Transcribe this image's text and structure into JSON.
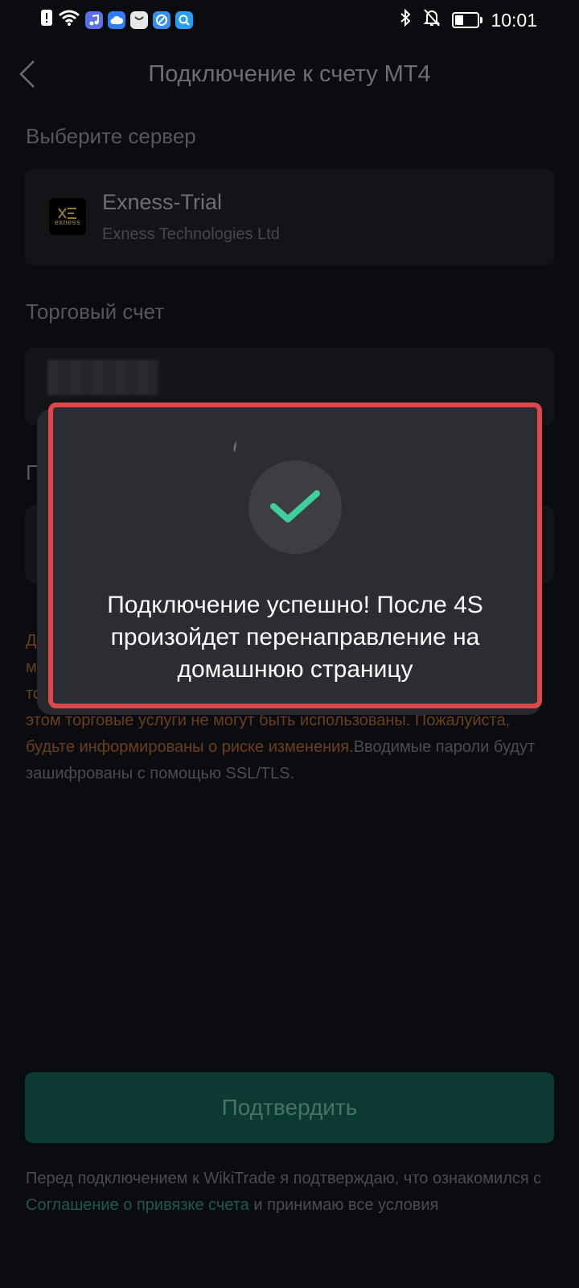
{
  "status_bar": {
    "time": "10:01",
    "battery_level": 0.4,
    "icons": [
      "alert-icon",
      "wifi-icon",
      "music-app-icon",
      "cloud-app-icon",
      "bag-app-icon",
      "browser-app-icon",
      "search-app-icon",
      "bluetooth-icon",
      "bell-off-icon",
      "battery-icon"
    ]
  },
  "header": {
    "title": "Подключение к счету MT4",
    "back_icon": "chevron-left-icon"
  },
  "server_section": {
    "label": "Выберите сервер",
    "server_name": "Exness-Trial",
    "server_company": "Exness Technologies Ltd",
    "logo_text": "exness"
  },
  "account_section": {
    "label": "Торговый счет"
  },
  "warning": {
    "line1": "Д",
    "line2": "м",
    "line3": "то",
    "text_orange": "этом торговые услуги не могут быть использованы. Пожалуйста, будьте информированы о риске изменения.",
    "text_gray": "Вводимые пароли будут зашифрованы с помощью SSL/TLS."
  },
  "password_label_fragment": "П",
  "confirm_button": {
    "label": "Подтвердить"
  },
  "agreement": {
    "text_before": "Перед подключением к WikiTrade я подтверждаю, что ознакомился с ",
    "link": "Соглашение о привязке счета",
    "text_after": " и принимаю все условия"
  },
  "toast": {
    "icon": "checkmark-icon",
    "message": "Подключение успешно! После 4S произойдет перенаправление на домашнюю страницу",
    "check_color": "#3ecf9c",
    "border_color": "#e0474a"
  }
}
